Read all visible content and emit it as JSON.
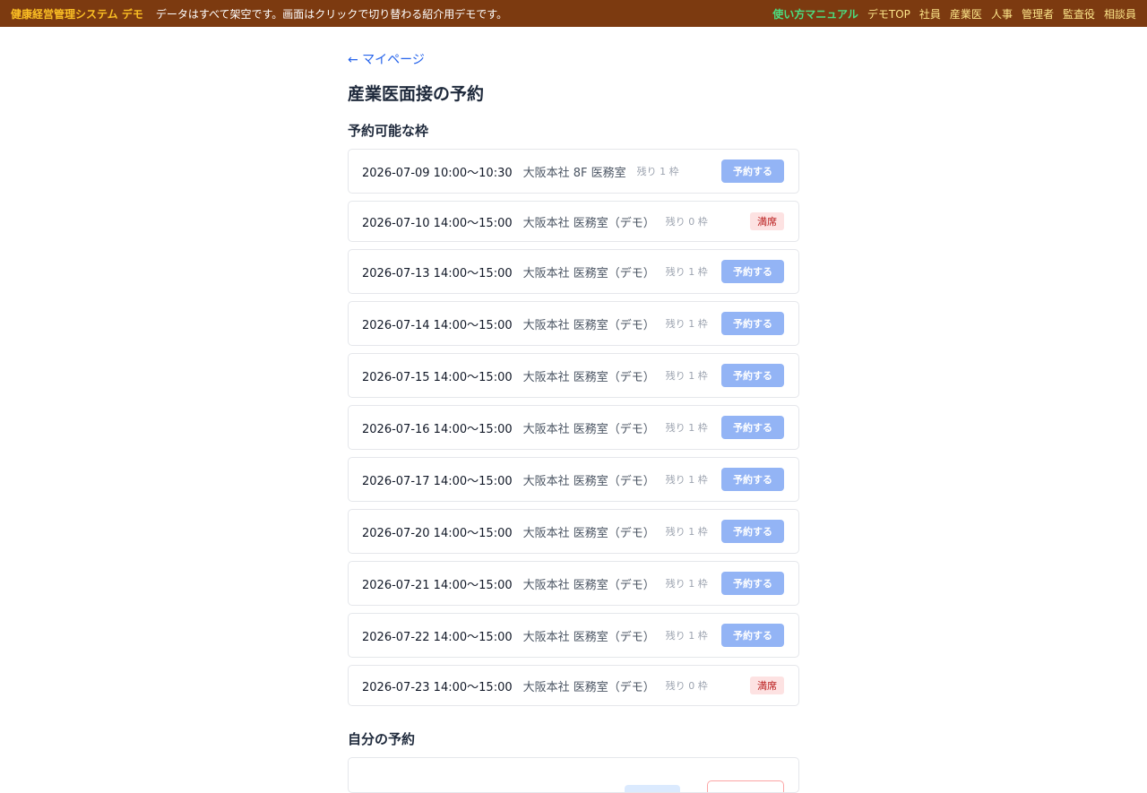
{
  "topbar": {
    "brand": "健康経営管理システム デモ",
    "notice": "データはすべて架空です。画面はクリックで切り替わる紹介用デモです。",
    "links": [
      "使い方マニュアル",
      "デモTOP",
      "社員",
      "産業医",
      "人事",
      "管理者",
      "監査役",
      "相談員"
    ]
  },
  "back_link": "← マイページ",
  "page_title": "産業医面接の予約",
  "available_title": "予約可能な枠",
  "reserve_label": "予約する",
  "full_label": "満席",
  "slots": [
    {
      "datetime": "2026-07-09 10:00〜10:30",
      "location": "大阪本社 8F 医務室",
      "remaining": "残り 1 枠",
      "status": "open"
    },
    {
      "datetime": "2026-07-10 14:00〜15:00",
      "location": "大阪本社 医務室（デモ）",
      "remaining": "残り 0 枠",
      "status": "full"
    },
    {
      "datetime": "2026-07-13 14:00〜15:00",
      "location": "大阪本社 医務室（デモ）",
      "remaining": "残り 1 枠",
      "status": "open"
    },
    {
      "datetime": "2026-07-14 14:00〜15:00",
      "location": "大阪本社 医務室（デモ）",
      "remaining": "残り 1 枠",
      "status": "open"
    },
    {
      "datetime": "2026-07-15 14:00〜15:00",
      "location": "大阪本社 医務室（デモ）",
      "remaining": "残り 1 枠",
      "status": "open"
    },
    {
      "datetime": "2026-07-16 14:00〜15:00",
      "location": "大阪本社 医務室（デモ）",
      "remaining": "残り 1 枠",
      "status": "open"
    },
    {
      "datetime": "2026-07-17 14:00〜15:00",
      "location": "大阪本社 医務室（デモ）",
      "remaining": "残り 1 枠",
      "status": "open"
    },
    {
      "datetime": "2026-07-20 14:00〜15:00",
      "location": "大阪本社 医務室（デモ）",
      "remaining": "残り 1 枠",
      "status": "open"
    },
    {
      "datetime": "2026-07-21 14:00〜15:00",
      "location": "大阪本社 医務室（デモ）",
      "remaining": "残り 1 枠",
      "status": "open"
    },
    {
      "datetime": "2026-07-22 14:00〜15:00",
      "location": "大阪本社 医務室（デモ）",
      "remaining": "残り 1 枠",
      "status": "open"
    },
    {
      "datetime": "2026-07-23 14:00〜15:00",
      "location": "大阪本社 医務室（デモ）",
      "remaining": "残り 0 枠",
      "status": "full"
    }
  ],
  "my_reservations_title": "自分の予約"
}
